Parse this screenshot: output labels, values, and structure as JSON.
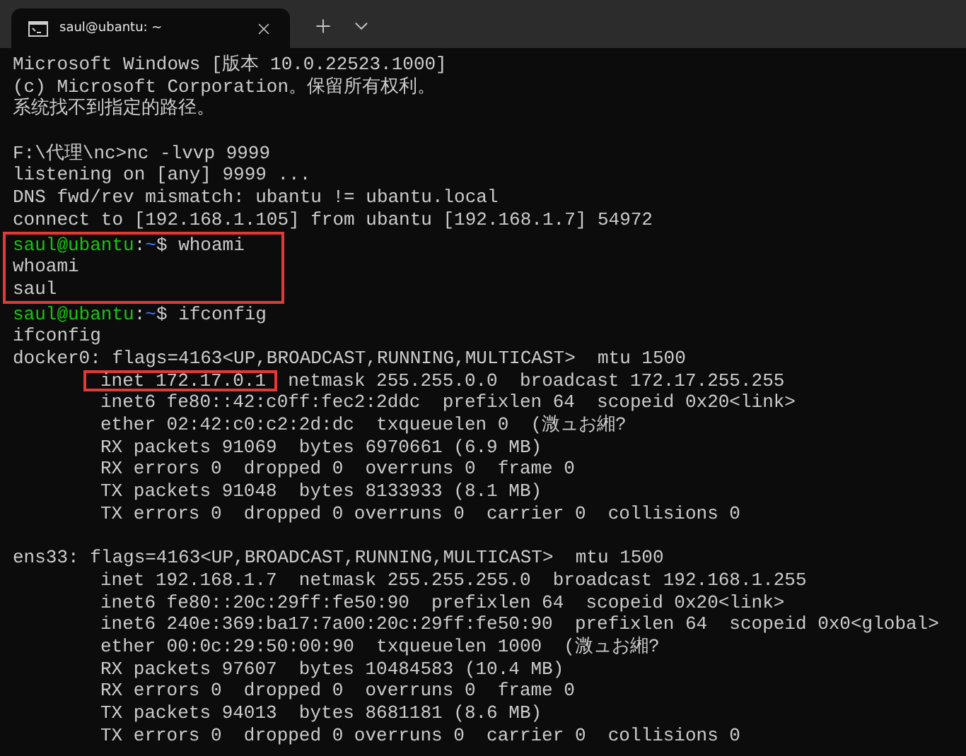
{
  "tab": {
    "title": "saul@ubantu: ~",
    "selected": true
  },
  "lines": [
    {
      "kind": "output",
      "text": "Microsoft Windows [版本 10.0.22523.1000]"
    },
    {
      "kind": "output",
      "text": "(c) Microsoft Corporation。保留所有权利。"
    },
    {
      "kind": "output",
      "text": "系统找不到指定的路径。"
    },
    {
      "kind": "blank"
    },
    {
      "kind": "output",
      "text": "F:\\代理\\nc>nc -lvvp 9999"
    },
    {
      "kind": "output",
      "text": "listening on [any] 9999 ..."
    },
    {
      "kind": "output",
      "text": "DNS fwd/rev mismatch: ubantu != ubantu.local"
    },
    {
      "kind": "output",
      "text": "connect to [192.168.1.105] from ubantu [192.168.1.7] 54972"
    },
    {
      "kind": "prompt",
      "boxed": true,
      "user": "saul@ubantu",
      "colon": ":",
      "path": "~",
      "symbol": "$",
      "command": "whoami"
    },
    {
      "kind": "output",
      "boxed": true,
      "text": "whoami"
    },
    {
      "kind": "output",
      "boxed": true,
      "text": "saul"
    },
    {
      "kind": "prompt",
      "boxed": false,
      "user": "saul@ubantu",
      "colon": ":",
      "path": "~",
      "symbol": "$",
      "command": "ifconfig"
    },
    {
      "kind": "output",
      "text": "ifconfig"
    },
    {
      "kind": "output",
      "text": "docker0: flags=4163<UP,BROADCAST,RUNNING,MULTICAST>  mtu 1500"
    },
    {
      "kind": "marked",
      "indent": true,
      "marked": "inet 172.17.0.1",
      "text": "  netmask 255.255.0.0  broadcast 172.17.255.255"
    },
    {
      "kind": "output",
      "indent": true,
      "text": "inet6 fe80::42:c0ff:fec2:2ddc  prefixlen 64  scopeid 0x20<link>"
    },
    {
      "kind": "output",
      "indent": true,
      "text": "ether 02:42:c0:c2:2d:dc  txqueuelen 0  (溦ュお緗?"
    },
    {
      "kind": "output",
      "indent": true,
      "text": "RX packets 91069  bytes 6970661 (6.9 MB)"
    },
    {
      "kind": "output",
      "indent": true,
      "text": "RX errors 0  dropped 0  overruns 0  frame 0"
    },
    {
      "kind": "output",
      "indent": true,
      "text": "TX packets 91048  bytes 8133933 (8.1 MB)"
    },
    {
      "kind": "output",
      "indent": true,
      "text": "TX errors 0  dropped 0 overruns 0  carrier 0  collisions 0"
    },
    {
      "kind": "blank"
    },
    {
      "kind": "output",
      "text": "ens33: flags=4163<UP,BROADCAST,RUNNING,MULTICAST>  mtu 1500"
    },
    {
      "kind": "output",
      "indent": true,
      "text": "inet 192.168.1.7  netmask 255.255.255.0  broadcast 192.168.1.255"
    },
    {
      "kind": "output",
      "indent": true,
      "text": "inet6 fe80::20c:29ff:fe50:90  prefixlen 64  scopeid 0x20<link>"
    },
    {
      "kind": "output",
      "indent": true,
      "text": "inet6 240e:369:ba17:7a00:20c:29ff:fe50:90  prefixlen 64  scopeid 0x0<global>"
    },
    {
      "kind": "output",
      "indent": true,
      "text": "ether 00:0c:29:50:00:90  txqueuelen 1000  (溦ュお緗?"
    },
    {
      "kind": "output",
      "indent": true,
      "text": "RX packets 97607  bytes 10484583 (10.4 MB)"
    },
    {
      "kind": "output",
      "indent": true,
      "text": "RX errors 0  dropped 0  overruns 0  frame 0"
    },
    {
      "kind": "output",
      "indent": true,
      "text": "TX packets 94013  bytes 8681181 (8.6 MB)"
    },
    {
      "kind": "output",
      "indent": true,
      "text": "TX errors 0  dropped 0 overruns 0  carrier 0  collisions 0"
    }
  ]
}
